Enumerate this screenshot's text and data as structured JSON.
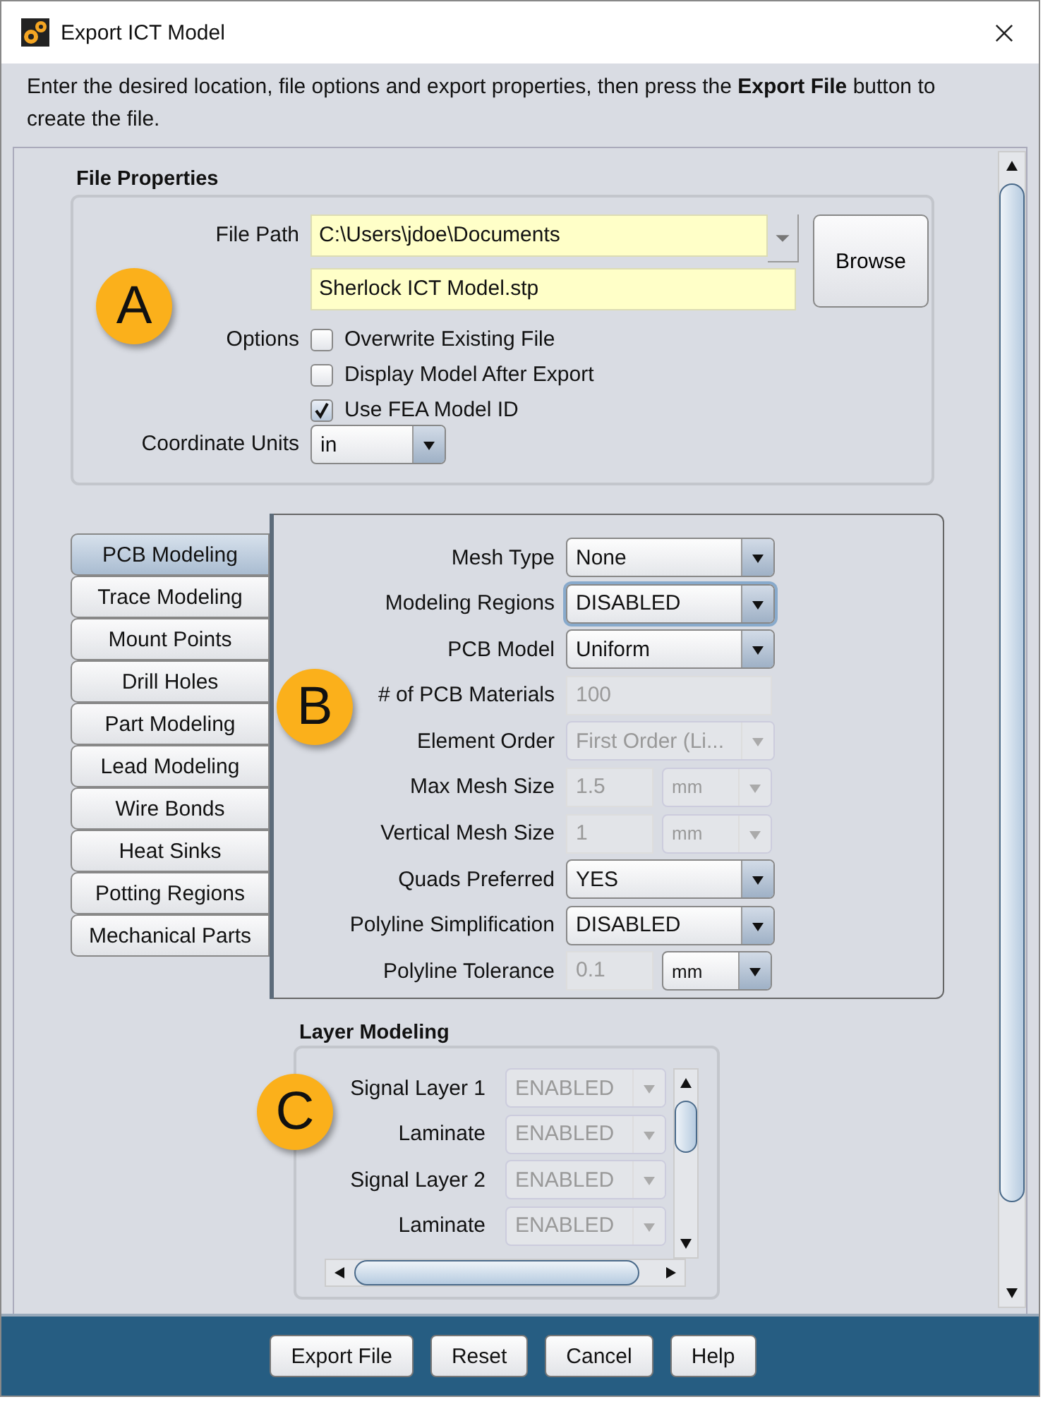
{
  "window": {
    "title": "Export ICT Model"
  },
  "instructions": "Enter the desired location, file options and export properties, then press the **Export File** button to create the file.",
  "file_properties": {
    "title": "File Properties",
    "callout": "A",
    "file_path": {
      "label": "File Path",
      "value": "C:\\Users\\jdoe\\Documents"
    },
    "file_name": {
      "value": "Sherlock ICT Model.stp"
    },
    "browse": "Browse",
    "options_label": "Options",
    "options": [
      {
        "label": "Overwrite Existing File",
        "checked": false
      },
      {
        "label": "Display Model After Export",
        "checked": false
      },
      {
        "label": "Use FEA Model ID",
        "checked": true
      }
    ],
    "units": {
      "label": "Coordinate Units",
      "value": "in"
    }
  },
  "modeling": {
    "callout": "B",
    "tabs": [
      {
        "label": "PCB Modeling",
        "selected": true
      },
      {
        "label": "Trace Modeling",
        "selected": false
      },
      {
        "label": "Mount Points",
        "selected": false
      },
      {
        "label": "Drill Holes",
        "selected": false
      },
      {
        "label": "Part Modeling",
        "selected": false
      },
      {
        "label": "Lead Modeling",
        "selected": false
      },
      {
        "label": "Wire Bonds",
        "selected": false
      },
      {
        "label": "Heat Sinks",
        "selected": false
      },
      {
        "label": "Potting Regions",
        "selected": false
      },
      {
        "label": "Mechanical Parts",
        "selected": false
      }
    ],
    "fields": [
      {
        "kind": "select",
        "label": "Mesh Type",
        "value": "None",
        "disabled": false,
        "focused": false
      },
      {
        "kind": "select",
        "label": "Modeling Regions",
        "value": "DISABLED",
        "disabled": false,
        "focused": true
      },
      {
        "kind": "select",
        "label": "PCB Model",
        "value": "Uniform",
        "disabled": false,
        "focused": false
      },
      {
        "kind": "text",
        "label": "# of PCB Materials",
        "value": "100",
        "disabled": true,
        "focused": false
      },
      {
        "kind": "select",
        "label": "Element Order",
        "value": "First Order (Li...",
        "disabled": true,
        "focused": false
      },
      {
        "kind": "text_unit",
        "label": "Max Mesh Size",
        "value": "1.5",
        "disabled": true,
        "focused": false,
        "unit": "mm",
        "unit_disabled": true
      },
      {
        "kind": "text_unit",
        "label": "Vertical Mesh Size",
        "value": "1",
        "disabled": true,
        "focused": false,
        "unit": "mm",
        "unit_disabled": true
      },
      {
        "kind": "select",
        "label": "Quads Preferred",
        "value": "YES",
        "disabled": false,
        "focused": false
      },
      {
        "kind": "select",
        "label": "Polyline Simplification",
        "value": "DISABLED",
        "disabled": false,
        "focused": false
      },
      {
        "kind": "text_unit",
        "label": "Polyline Tolerance",
        "value": "0.1",
        "disabled": true,
        "focused": false,
        "unit": "mm",
        "unit_disabled": false
      }
    ]
  },
  "layer_modeling": {
    "title": "Layer Modeling",
    "callout": "C",
    "rows": [
      {
        "label": "Signal Layer 1",
        "value": "ENABLED",
        "disabled": true
      },
      {
        "label": "Laminate",
        "value": "ENABLED",
        "disabled": true
      },
      {
        "label": "Signal Layer 2",
        "value": "ENABLED",
        "disabled": true
      },
      {
        "label": "Laminate",
        "value": "ENABLED",
        "disabled": true
      }
    ]
  },
  "buttons": [
    "Export File",
    "Reset",
    "Cancel",
    "Help"
  ]
}
